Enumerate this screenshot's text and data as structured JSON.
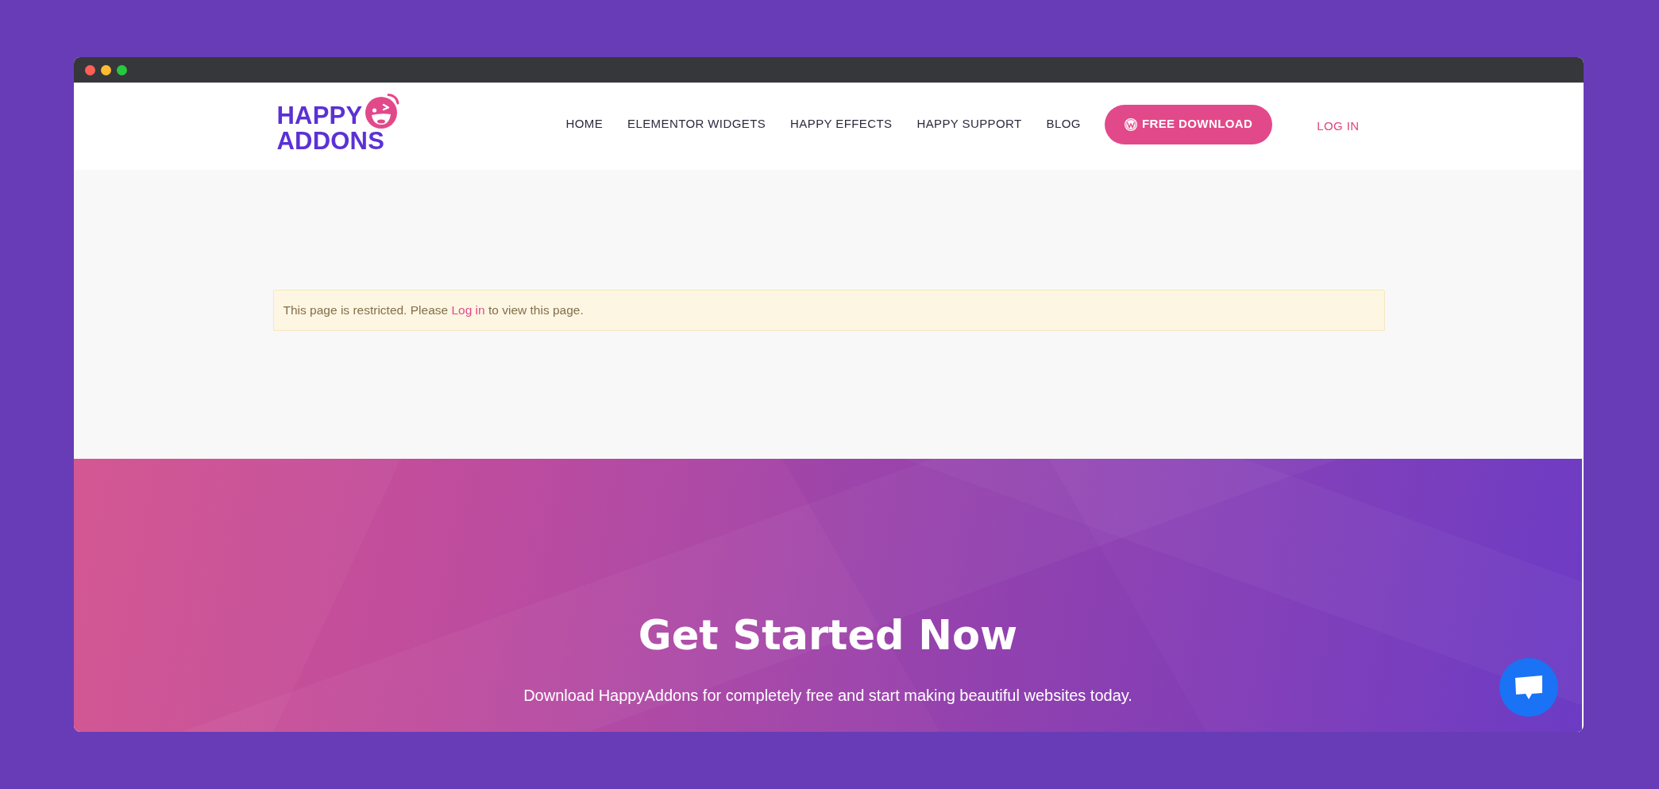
{
  "browser_frame": {
    "dots": [
      {
        "color": "#ff5f57"
      },
      {
        "color": "#febc2e"
      },
      {
        "color": "#28c840"
      }
    ]
  },
  "header": {
    "logo": {
      "line_1": "HAPPY",
      "line_2": "ADDONS"
    },
    "nav": [
      {
        "label": "HOME"
      },
      {
        "label": "ELEMENTOR WIDGETS"
      },
      {
        "label": "HAPPY EFFECTS"
      },
      {
        "label": "HAPPY SUPPORT"
      },
      {
        "label": "BLOG"
      }
    ],
    "download_button": {
      "label": "FREE DOWNLOAD"
    },
    "login_link": {
      "label": "LOG IN"
    }
  },
  "notice": {
    "before_link": "This page is restricted. Please",
    "link": "Log in",
    "after_link": "to view this page."
  },
  "cta": {
    "title": "Get Started Now",
    "subtitle": "Download HappyAddons for completely free and start making beautiful websites today."
  }
}
